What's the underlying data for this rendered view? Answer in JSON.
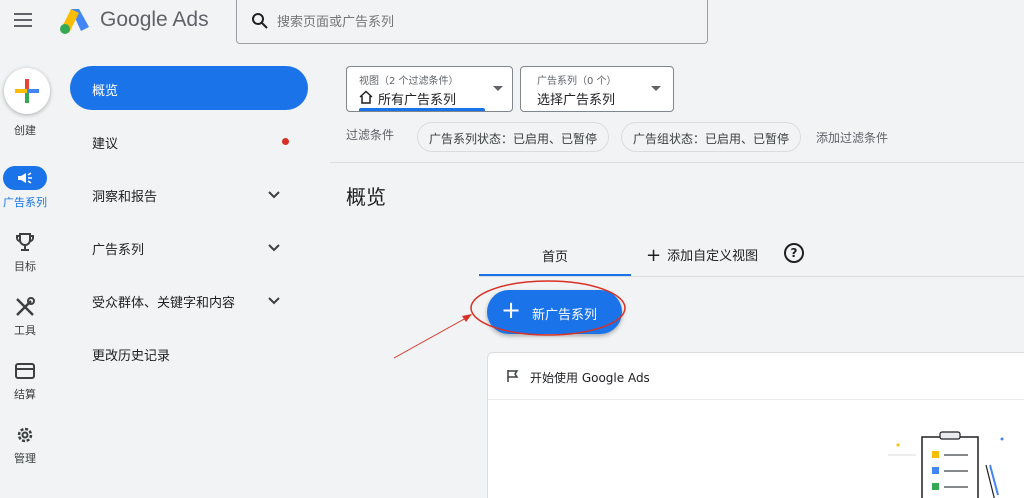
{
  "app": {
    "logo_text": "Google Ads"
  },
  "search": {
    "placeholder": "搜索页面或广告系列"
  },
  "rail": {
    "create_label": "创建",
    "items": [
      {
        "label": "广告系列",
        "icon": "megaphone-icon",
        "active": true
      },
      {
        "label": "目标",
        "icon": "trophy-icon"
      },
      {
        "label": "工具",
        "icon": "tools-icon"
      },
      {
        "label": "结算",
        "icon": "credit-card-icon"
      },
      {
        "label": "管理",
        "icon": "gear-icon"
      }
    ]
  },
  "nav": {
    "items": [
      {
        "label": "概览",
        "active": true
      },
      {
        "label": "建议",
        "badge": "red-dot"
      },
      {
        "label": "洞察和报告",
        "expandable": true
      },
      {
        "label": "广告系列",
        "expandable": true
      },
      {
        "label": "受众群体、关键字和内容",
        "expandable": true
      },
      {
        "label": "更改历史记录"
      }
    ]
  },
  "view_selector": {
    "caption": "视图（2 个过滤条件）",
    "value": "所有广告系列"
  },
  "campaign_selector": {
    "caption": "广告系列（0 个）",
    "value": "选择广告系列"
  },
  "filters": {
    "label": "过滤条件",
    "chips": [
      "广告系列状态：已启用、已暂停",
      "广告组状态：已启用、已暂停"
    ],
    "add_label": "添加过滤条件"
  },
  "page": {
    "title": "概览"
  },
  "tabs": {
    "home": "首页",
    "add_view": "添加自定义视图",
    "help_glyph": "?"
  },
  "new_campaign": {
    "label": "新广告系列",
    "plus": "+"
  },
  "card": {
    "title": "开始使用 Google Ads"
  },
  "colors": {
    "accent": "#1a73e8",
    "annotation": "#d93025"
  }
}
